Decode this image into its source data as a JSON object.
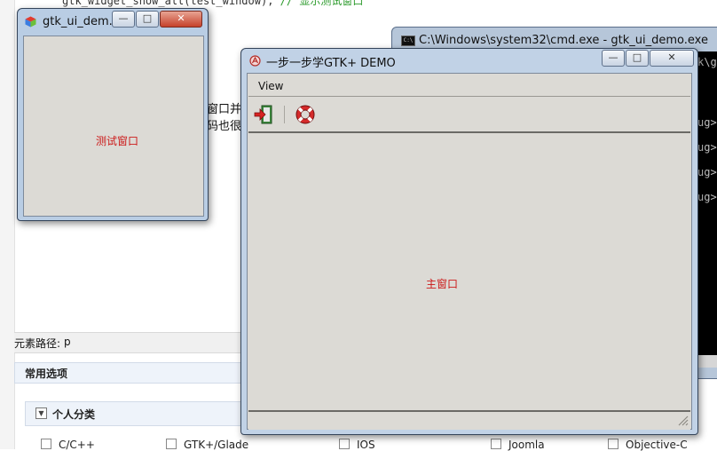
{
  "background_page": {
    "code_line": "gtk_widget_show_all(test_window);",
    "code_comment": "// 显示测试窗口",
    "text_fragment_1": "窗口并",
    "text_fragment_2": "码也很",
    "element_path_label": "元素路径:",
    "element_path_value": "p",
    "common_options_title": "常用选项",
    "personal_category_title": "个人分类",
    "categories": [
      "C/C++",
      "GTK+/Glade",
      "IOS",
      "Joomla",
      "Objective-C"
    ]
  },
  "cmd_window": {
    "title": "C:\\Windows\\system32\\cmd.exe - gtk_ui_demo.exe",
    "lines": [
      "k\\g",
      "ug>",
      "ug>",
      "ug>",
      "ug>"
    ]
  },
  "test_window": {
    "title": "gtk_ui_dem...",
    "label": "测试窗口",
    "buttons": {
      "minimize": "—",
      "maximize": "□",
      "close": "✕"
    }
  },
  "main_window": {
    "title": "一步一步学GTK+ DEMO",
    "menu": [
      "View"
    ],
    "toolbar": [
      {
        "name": "quit",
        "icon": "exit-door-icon"
      },
      {
        "name": "help",
        "icon": "lifebuoy-icon"
      }
    ],
    "label": "主窗口",
    "buttons": {
      "minimize": "—",
      "maximize": "□",
      "close": "✕"
    }
  },
  "colors": {
    "window_frame": "#c1d2e6",
    "client_bg": "#dcdad5",
    "label_red": "#cc1a1a",
    "console_bg": "#000000"
  }
}
